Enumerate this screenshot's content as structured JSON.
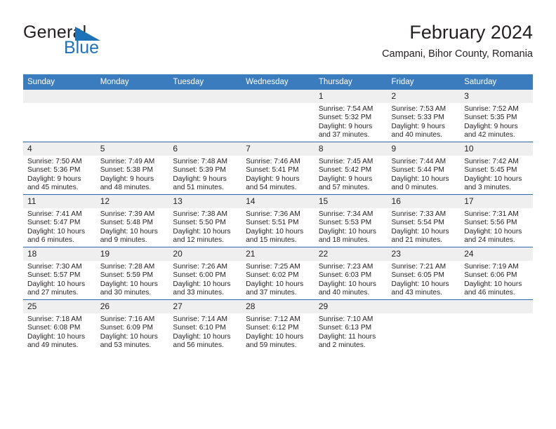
{
  "brand": {
    "name_dark": "General",
    "name_blue": "Blue",
    "flag_icon": "triangle-flag-icon",
    "accent_color": "#1e72b8"
  },
  "header": {
    "title": "February 2024",
    "subtitle": "Campani, Bihor County, Romania"
  },
  "calendar": {
    "header_bg": "#3a7cbe",
    "row_divider_color": "#2d6aab",
    "daynum_bg": "#efefef",
    "weekdays": [
      "Sunday",
      "Monday",
      "Tuesday",
      "Wednesday",
      "Thursday",
      "Friday",
      "Saturday"
    ],
    "weeks": [
      [
        {
          "day": "",
          "blank": true
        },
        {
          "day": "",
          "blank": true
        },
        {
          "day": "",
          "blank": true
        },
        {
          "day": "",
          "blank": true
        },
        {
          "day": "1",
          "sunrise": "Sunrise: 7:54 AM",
          "sunset": "Sunset: 5:32 PM",
          "daylight": "Daylight: 9 hours and 37 minutes."
        },
        {
          "day": "2",
          "sunrise": "Sunrise: 7:53 AM",
          "sunset": "Sunset: 5:33 PM",
          "daylight": "Daylight: 9 hours and 40 minutes."
        },
        {
          "day": "3",
          "sunrise": "Sunrise: 7:52 AM",
          "sunset": "Sunset: 5:35 PM",
          "daylight": "Daylight: 9 hours and 42 minutes."
        }
      ],
      [
        {
          "day": "4",
          "sunrise": "Sunrise: 7:50 AM",
          "sunset": "Sunset: 5:36 PM",
          "daylight": "Daylight: 9 hours and 45 minutes."
        },
        {
          "day": "5",
          "sunrise": "Sunrise: 7:49 AM",
          "sunset": "Sunset: 5:38 PM",
          "daylight": "Daylight: 9 hours and 48 minutes."
        },
        {
          "day": "6",
          "sunrise": "Sunrise: 7:48 AM",
          "sunset": "Sunset: 5:39 PM",
          "daylight": "Daylight: 9 hours and 51 minutes."
        },
        {
          "day": "7",
          "sunrise": "Sunrise: 7:46 AM",
          "sunset": "Sunset: 5:41 PM",
          "daylight": "Daylight: 9 hours and 54 minutes."
        },
        {
          "day": "8",
          "sunrise": "Sunrise: 7:45 AM",
          "sunset": "Sunset: 5:42 PM",
          "daylight": "Daylight: 9 hours and 57 minutes."
        },
        {
          "day": "9",
          "sunrise": "Sunrise: 7:44 AM",
          "sunset": "Sunset: 5:44 PM",
          "daylight": "Daylight: 10 hours and 0 minutes."
        },
        {
          "day": "10",
          "sunrise": "Sunrise: 7:42 AM",
          "sunset": "Sunset: 5:45 PM",
          "daylight": "Daylight: 10 hours and 3 minutes."
        }
      ],
      [
        {
          "day": "11",
          "sunrise": "Sunrise: 7:41 AM",
          "sunset": "Sunset: 5:47 PM",
          "daylight": "Daylight: 10 hours and 6 minutes."
        },
        {
          "day": "12",
          "sunrise": "Sunrise: 7:39 AM",
          "sunset": "Sunset: 5:48 PM",
          "daylight": "Daylight: 10 hours and 9 minutes."
        },
        {
          "day": "13",
          "sunrise": "Sunrise: 7:38 AM",
          "sunset": "Sunset: 5:50 PM",
          "daylight": "Daylight: 10 hours and 12 minutes."
        },
        {
          "day": "14",
          "sunrise": "Sunrise: 7:36 AM",
          "sunset": "Sunset: 5:51 PM",
          "daylight": "Daylight: 10 hours and 15 minutes."
        },
        {
          "day": "15",
          "sunrise": "Sunrise: 7:34 AM",
          "sunset": "Sunset: 5:53 PM",
          "daylight": "Daylight: 10 hours and 18 minutes."
        },
        {
          "day": "16",
          "sunrise": "Sunrise: 7:33 AM",
          "sunset": "Sunset: 5:54 PM",
          "daylight": "Daylight: 10 hours and 21 minutes."
        },
        {
          "day": "17",
          "sunrise": "Sunrise: 7:31 AM",
          "sunset": "Sunset: 5:56 PM",
          "daylight": "Daylight: 10 hours and 24 minutes."
        }
      ],
      [
        {
          "day": "18",
          "sunrise": "Sunrise: 7:30 AM",
          "sunset": "Sunset: 5:57 PM",
          "daylight": "Daylight: 10 hours and 27 minutes."
        },
        {
          "day": "19",
          "sunrise": "Sunrise: 7:28 AM",
          "sunset": "Sunset: 5:59 PM",
          "daylight": "Daylight: 10 hours and 30 minutes."
        },
        {
          "day": "20",
          "sunrise": "Sunrise: 7:26 AM",
          "sunset": "Sunset: 6:00 PM",
          "daylight": "Daylight: 10 hours and 33 minutes."
        },
        {
          "day": "21",
          "sunrise": "Sunrise: 7:25 AM",
          "sunset": "Sunset: 6:02 PM",
          "daylight": "Daylight: 10 hours and 37 minutes."
        },
        {
          "day": "22",
          "sunrise": "Sunrise: 7:23 AM",
          "sunset": "Sunset: 6:03 PM",
          "daylight": "Daylight: 10 hours and 40 minutes."
        },
        {
          "day": "23",
          "sunrise": "Sunrise: 7:21 AM",
          "sunset": "Sunset: 6:05 PM",
          "daylight": "Daylight: 10 hours and 43 minutes."
        },
        {
          "day": "24",
          "sunrise": "Sunrise: 7:19 AM",
          "sunset": "Sunset: 6:06 PM",
          "daylight": "Daylight: 10 hours and 46 minutes."
        }
      ],
      [
        {
          "day": "25",
          "sunrise": "Sunrise: 7:18 AM",
          "sunset": "Sunset: 6:08 PM",
          "daylight": "Daylight: 10 hours and 49 minutes."
        },
        {
          "day": "26",
          "sunrise": "Sunrise: 7:16 AM",
          "sunset": "Sunset: 6:09 PM",
          "daylight": "Daylight: 10 hours and 53 minutes."
        },
        {
          "day": "27",
          "sunrise": "Sunrise: 7:14 AM",
          "sunset": "Sunset: 6:10 PM",
          "daylight": "Daylight: 10 hours and 56 minutes."
        },
        {
          "day": "28",
          "sunrise": "Sunrise: 7:12 AM",
          "sunset": "Sunset: 6:12 PM",
          "daylight": "Daylight: 10 hours and 59 minutes."
        },
        {
          "day": "29",
          "sunrise": "Sunrise: 7:10 AM",
          "sunset": "Sunset: 6:13 PM",
          "daylight": "Daylight: 11 hours and 2 minutes."
        },
        {
          "day": "",
          "blank": true
        },
        {
          "day": "",
          "blank": true
        }
      ]
    ]
  }
}
